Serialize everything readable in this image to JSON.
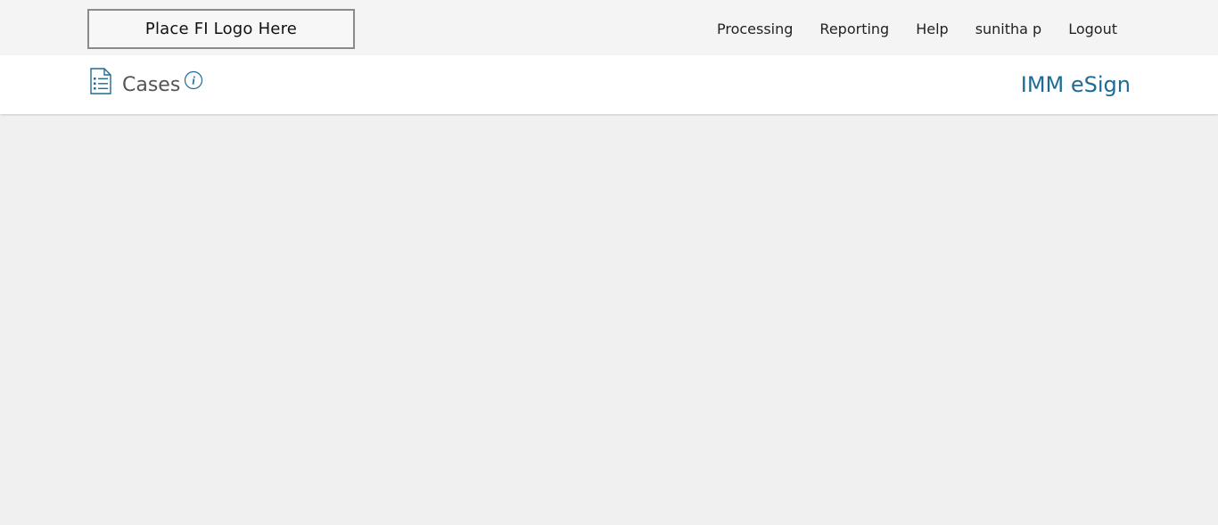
{
  "header": {
    "logo_text": "Place FI Logo Here",
    "nav": [
      {
        "label": "Processing"
      },
      {
        "label": "Reporting"
      },
      {
        "label": "Help"
      },
      {
        "label": "sunitha p"
      },
      {
        "label": "Logout"
      }
    ]
  },
  "subheader": {
    "page_title": "Cases",
    "page_icon": "list-document-icon",
    "info_icon": "info-icon",
    "app_name": "IMM eSign"
  },
  "colors": {
    "accent": "#1e6b96",
    "topbar_bg": "#f4f4f4",
    "page_bg": "#f0f0f0"
  }
}
